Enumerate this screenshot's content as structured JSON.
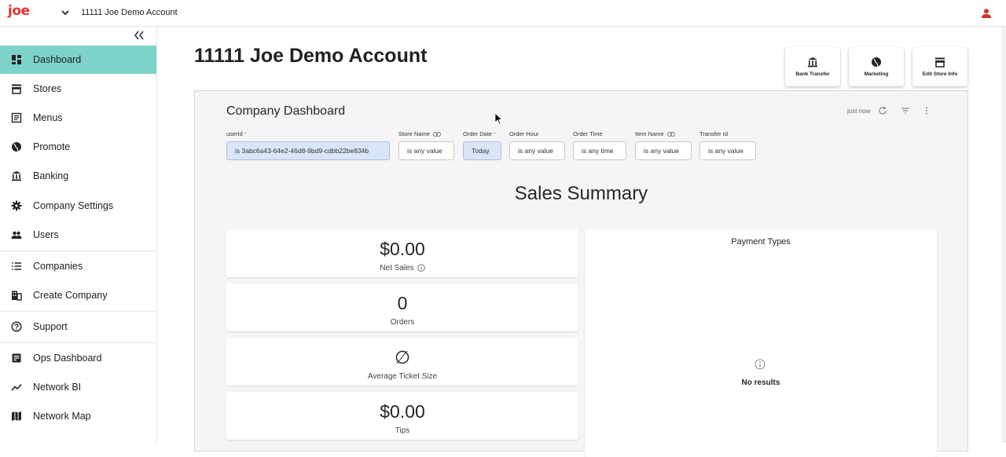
{
  "app": {
    "logo": "joe",
    "account_name": "11111 Joe Demo Account"
  },
  "sidebar": {
    "items": [
      {
        "label": "Dashboard",
        "icon": "dashboard-icon",
        "active": true
      },
      {
        "label": "Stores",
        "icon": "store-icon"
      },
      {
        "label": "Menus",
        "icon": "menu-book-icon"
      },
      {
        "label": "Promote",
        "icon": "globe-icon"
      },
      {
        "label": "Banking",
        "icon": "bank-icon"
      },
      {
        "label": "Company Settings",
        "icon": "gear-icon"
      },
      {
        "label": "Users",
        "icon": "people-icon"
      },
      {
        "label": "Companies",
        "icon": "list-icon"
      },
      {
        "label": "Create Company",
        "icon": "building-icon"
      },
      {
        "label": "Support",
        "icon": "help-circle-icon"
      },
      {
        "label": "Ops Dashboard",
        "icon": "ops-dashboard-icon"
      },
      {
        "label": "Network BI",
        "icon": "trend-line-icon"
      },
      {
        "label": "Network Map",
        "icon": "map-icon"
      }
    ]
  },
  "page": {
    "title": "11111 Joe Demo Account",
    "actions": [
      {
        "label": "Bank Transfer",
        "icon": "bank-icon"
      },
      {
        "label": "Marketing",
        "icon": "globe-icon"
      },
      {
        "label": "Edit Store Info",
        "icon": "store-icon"
      }
    ]
  },
  "dashboard": {
    "title": "Company Dashboard",
    "last_updated": "just now",
    "filters": [
      {
        "label": "userId",
        "required": "*",
        "value": "is 3abc6a43-64e2-46d8-9bd9-cdbb22be834b",
        "selected": true
      },
      {
        "label": "Store Name",
        "linked": true,
        "value": "is any value"
      },
      {
        "label": "Order Date",
        "required": "*",
        "value": "Today",
        "selected": true
      },
      {
        "label": "Order Hour",
        "value": "is any value"
      },
      {
        "label": "Order Time",
        "value": "is any time"
      },
      {
        "label": "Item Name",
        "linked": true,
        "value": "is any value"
      },
      {
        "label": "Transfer Id",
        "value": "is any value"
      }
    ],
    "summary_title": "Sales Summary",
    "tiles": [
      {
        "value": "$0.00",
        "caption": "Net Sales",
        "info": true
      },
      {
        "value": "0",
        "caption": "Orders"
      },
      {
        "value": "∅",
        "caption": "Average Ticket Size"
      },
      {
        "value": "$0.00",
        "caption": "Tips"
      }
    ],
    "payment_types": {
      "title": "Payment Types",
      "empty_text": "No results"
    }
  }
}
